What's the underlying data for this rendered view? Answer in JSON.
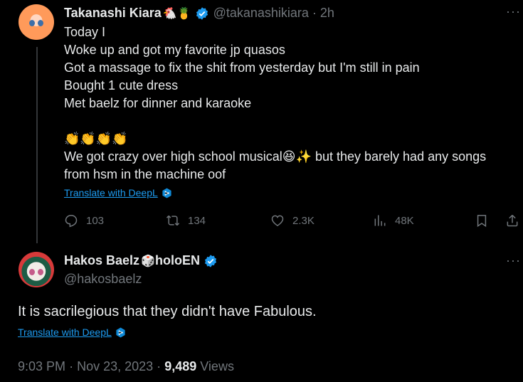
{
  "tweet": {
    "author_name": "Takanashi Kiara",
    "author_emojis": "🐔🍍",
    "handle": "@takanashikiara",
    "separator": "·",
    "time": "2h",
    "more": "···",
    "lines": [
      "Today I",
      "Woke up and got my favorite jp quasos",
      "Got a massage to fix the shit from yesterday but I'm still in pain",
      "Bought 1 cute dress",
      "Met baelz for dinner and karaoke",
      "",
      "👏👏👏👏",
      "We got crazy over high school musical😆✨ but they barely had any songs",
      "from hsm in the machine oof"
    ],
    "translate": "Translate with DeepL",
    "actions": {
      "replies": "103",
      "reposts": "134",
      "likes": "2.3K",
      "views": "48K"
    }
  },
  "reply": {
    "author_name": "Hakos Baelz",
    "author_emoji": "🎲",
    "author_suffix": "holoEN",
    "handle": "@hakosbaelz",
    "more": "···",
    "text": "It is sacrilegious that they didn't have Fabulous.",
    "translate": "Translate with DeepL",
    "time": "9:03 PM",
    "date_sep": "·",
    "date": "Nov 23, 2023",
    "views_sep": "·",
    "views_count": "9,489",
    "views_label": "Views"
  },
  "colors": {
    "background": "#000000",
    "text": "#e7e9ea",
    "muted": "#71767b",
    "link": "#1d9bf0",
    "verified": "#1d9bf0"
  }
}
